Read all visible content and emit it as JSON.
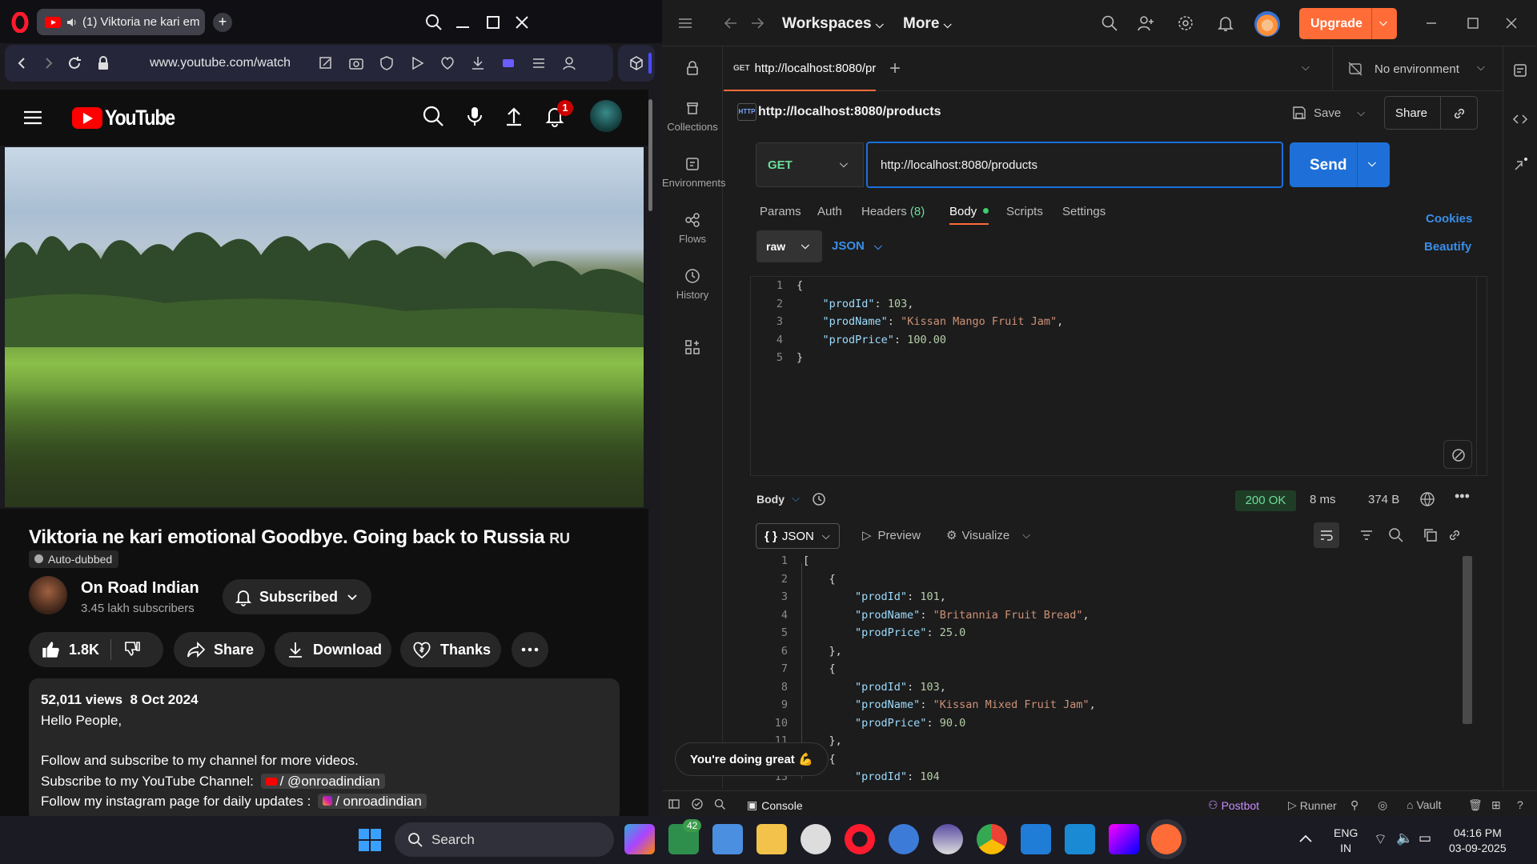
{
  "browser": {
    "tab_title": "(1) Viktoria ne kari em",
    "url": "www.youtube.com/watch"
  },
  "youtube": {
    "logo_text": "YouTube",
    "notification_count": "1",
    "video": {
      "title": "Viktoria ne kari emotional Goodbye. Going back to Russia",
      "lang_badge": "RU",
      "auto_dubbed": "Auto-dubbed"
    },
    "channel": {
      "name": "On Road Indian",
      "subscribers": "3.45 lakh subscribers",
      "subscribed_label": "Subscribed"
    },
    "actions": {
      "likes": "1.8K",
      "share": "Share",
      "download": "Download",
      "thanks": "Thanks"
    },
    "description": {
      "views": "52,011 views",
      "date": "8 Oct 2024",
      "line1": "Hello People,",
      "line2": "Follow and subscribe to my channel for more videos.",
      "line3": "Subscribe to my YouTube Channel:",
      "line3_link": "/ @onroadindian",
      "line4": "Follow my instagram page for daily updates :",
      "line4_link": "/ onroadindian"
    }
  },
  "postman": {
    "top": {
      "workspaces": "Workspaces",
      "more": "More",
      "upgrade": "Upgrade"
    },
    "sidebar": [
      {
        "label": "Collections",
        "icon": "collections-icon"
      },
      {
        "label": "Environments",
        "icon": "environments-icon"
      },
      {
        "label": "Flows",
        "icon": "flows-icon"
      },
      {
        "label": "History",
        "icon": "history-icon"
      }
    ],
    "tab": {
      "method": "GET",
      "title": "http://localhost:8080/pr"
    },
    "environment": "No environment",
    "request": {
      "name": "http://localhost:8080/products",
      "http_badge": "HTTP",
      "save": "Save",
      "share": "Share",
      "method": "GET",
      "url": "http://localhost:8080/products",
      "send": "Send"
    },
    "request_tabs": {
      "params": "Params",
      "auth": "Auth",
      "headers": "Headers",
      "headers_count": "(8)",
      "body": "Body",
      "scripts": "Scripts",
      "settings": "Settings",
      "cookies": "Cookies",
      "beautify": "Beautify"
    },
    "body_mode": "raw",
    "body_lang": "JSON",
    "request_body": {
      "open": "{",
      "close": "}",
      "fields": [
        {
          "key": "\"prodId\"",
          "value": "103",
          "kind": "n"
        },
        {
          "key": "\"prodName\"",
          "value": "\"Kissan Mango Fruit Jam\"",
          "kind": "s"
        },
        {
          "key": "\"prodPrice\"",
          "value": "100.00",
          "kind": "n"
        }
      ]
    },
    "response": {
      "label": "Body",
      "status": "200 OK",
      "time": "8 ms",
      "size": "374 B",
      "format": "JSON",
      "preview": "Preview",
      "visualize": "Visualize",
      "items": [
        {
          "prodId": "101",
          "prodName": "\"Britannia Fruit Bread\"",
          "prodPrice": "25.0"
        },
        {
          "prodId": "103",
          "prodName": "\"Kissan Mixed Fruit Jam\"",
          "prodPrice": "90.0"
        },
        {
          "prodId": "104"
        }
      ]
    },
    "toast": "You're doing great 💪",
    "status_bar": {
      "console": "Console",
      "postbot": "Postbot",
      "runner": "Runner",
      "vault": "Vault"
    }
  },
  "taskbar": {
    "search_placeholder": "Search",
    "badge": "42",
    "lang_line1": "ENG",
    "lang_line2": "IN",
    "time": "04:16 PM",
    "date": "03-09-2025"
  },
  "colors": {
    "postman_orange": "#ff6c37",
    "send_blue": "#1e70d8",
    "youtube_red": "#ff0000",
    "status_green": "#6bdd9a"
  }
}
